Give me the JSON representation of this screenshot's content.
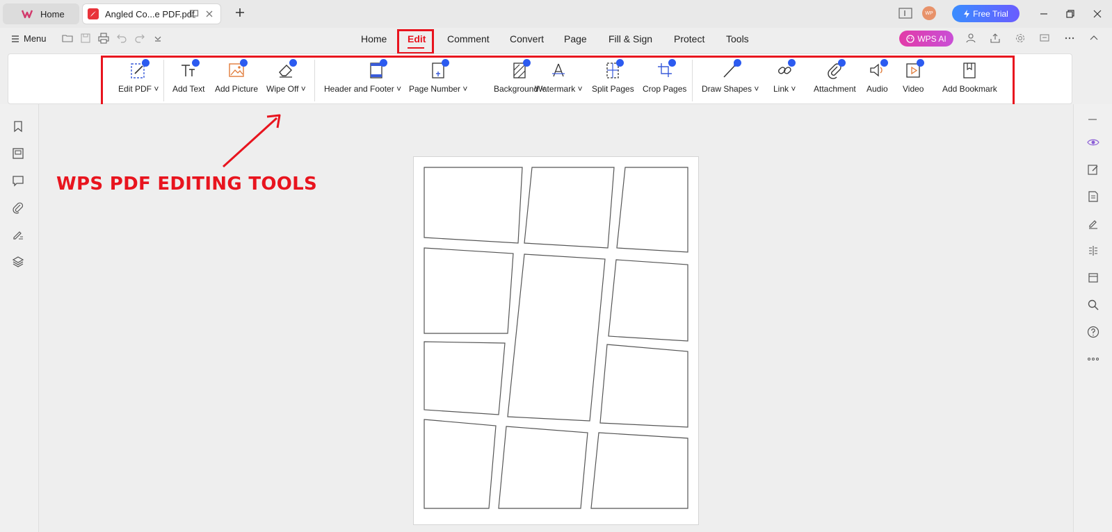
{
  "tabs": {
    "home_label": "Home",
    "doc_label": "Angled Co...e PDF.pdf"
  },
  "top": {
    "free_trial": "Free Trial",
    "avatar_text": "WP"
  },
  "toolbar": {
    "menu_label": "Menu",
    "wps_ai_label": "WPS AI"
  },
  "nav": [
    "Home",
    "Edit",
    "Comment",
    "Convert",
    "Page",
    "Fill & Sign",
    "Protect",
    "Tools"
  ],
  "ribbon": {
    "tools": [
      {
        "label": "Edit PDF",
        "dropdown": true,
        "icon": "edit-pdf-icon"
      },
      {
        "label": "Add Text",
        "dropdown": false,
        "icon": "add-text-icon"
      },
      {
        "label": "Add Picture",
        "dropdown": false,
        "icon": "add-picture-icon"
      },
      {
        "label": "Wipe Off",
        "dropdown": true,
        "icon": "eraser-icon"
      },
      {
        "label": "Header and Footer",
        "dropdown": true,
        "icon": "header-footer-icon"
      },
      {
        "label": "Page Number",
        "dropdown": true,
        "icon": "page-number-icon"
      },
      {
        "label": "Background",
        "dropdown": true,
        "icon": "background-icon"
      },
      {
        "label": "Watermark",
        "dropdown": true,
        "icon": "watermark-icon"
      },
      {
        "label": "Split Pages",
        "dropdown": false,
        "icon": "split-pages-icon"
      },
      {
        "label": "Crop Pages",
        "dropdown": false,
        "icon": "crop-pages-icon"
      },
      {
        "label": "Draw Shapes",
        "dropdown": true,
        "icon": "draw-shapes-icon"
      },
      {
        "label": "Link",
        "dropdown": true,
        "icon": "link-icon"
      },
      {
        "label": "Attachment",
        "dropdown": false,
        "icon": "attachment-icon"
      },
      {
        "label": "Audio",
        "dropdown": false,
        "icon": "audio-icon"
      },
      {
        "label": "Video",
        "dropdown": false,
        "icon": "video-icon"
      },
      {
        "label": "Add Bookmark",
        "dropdown": false,
        "icon": "bookmark-icon"
      }
    ]
  },
  "annotation": {
    "callout_text": "WPS PDF EDITING TOOLS",
    "color": "#e8141e"
  },
  "colors": {
    "accent_red": "#e8141e",
    "tool_badge": "#2c5bf0",
    "free_trial_start": "#3a8dff",
    "wps_ai_start": "#e23ba8"
  }
}
